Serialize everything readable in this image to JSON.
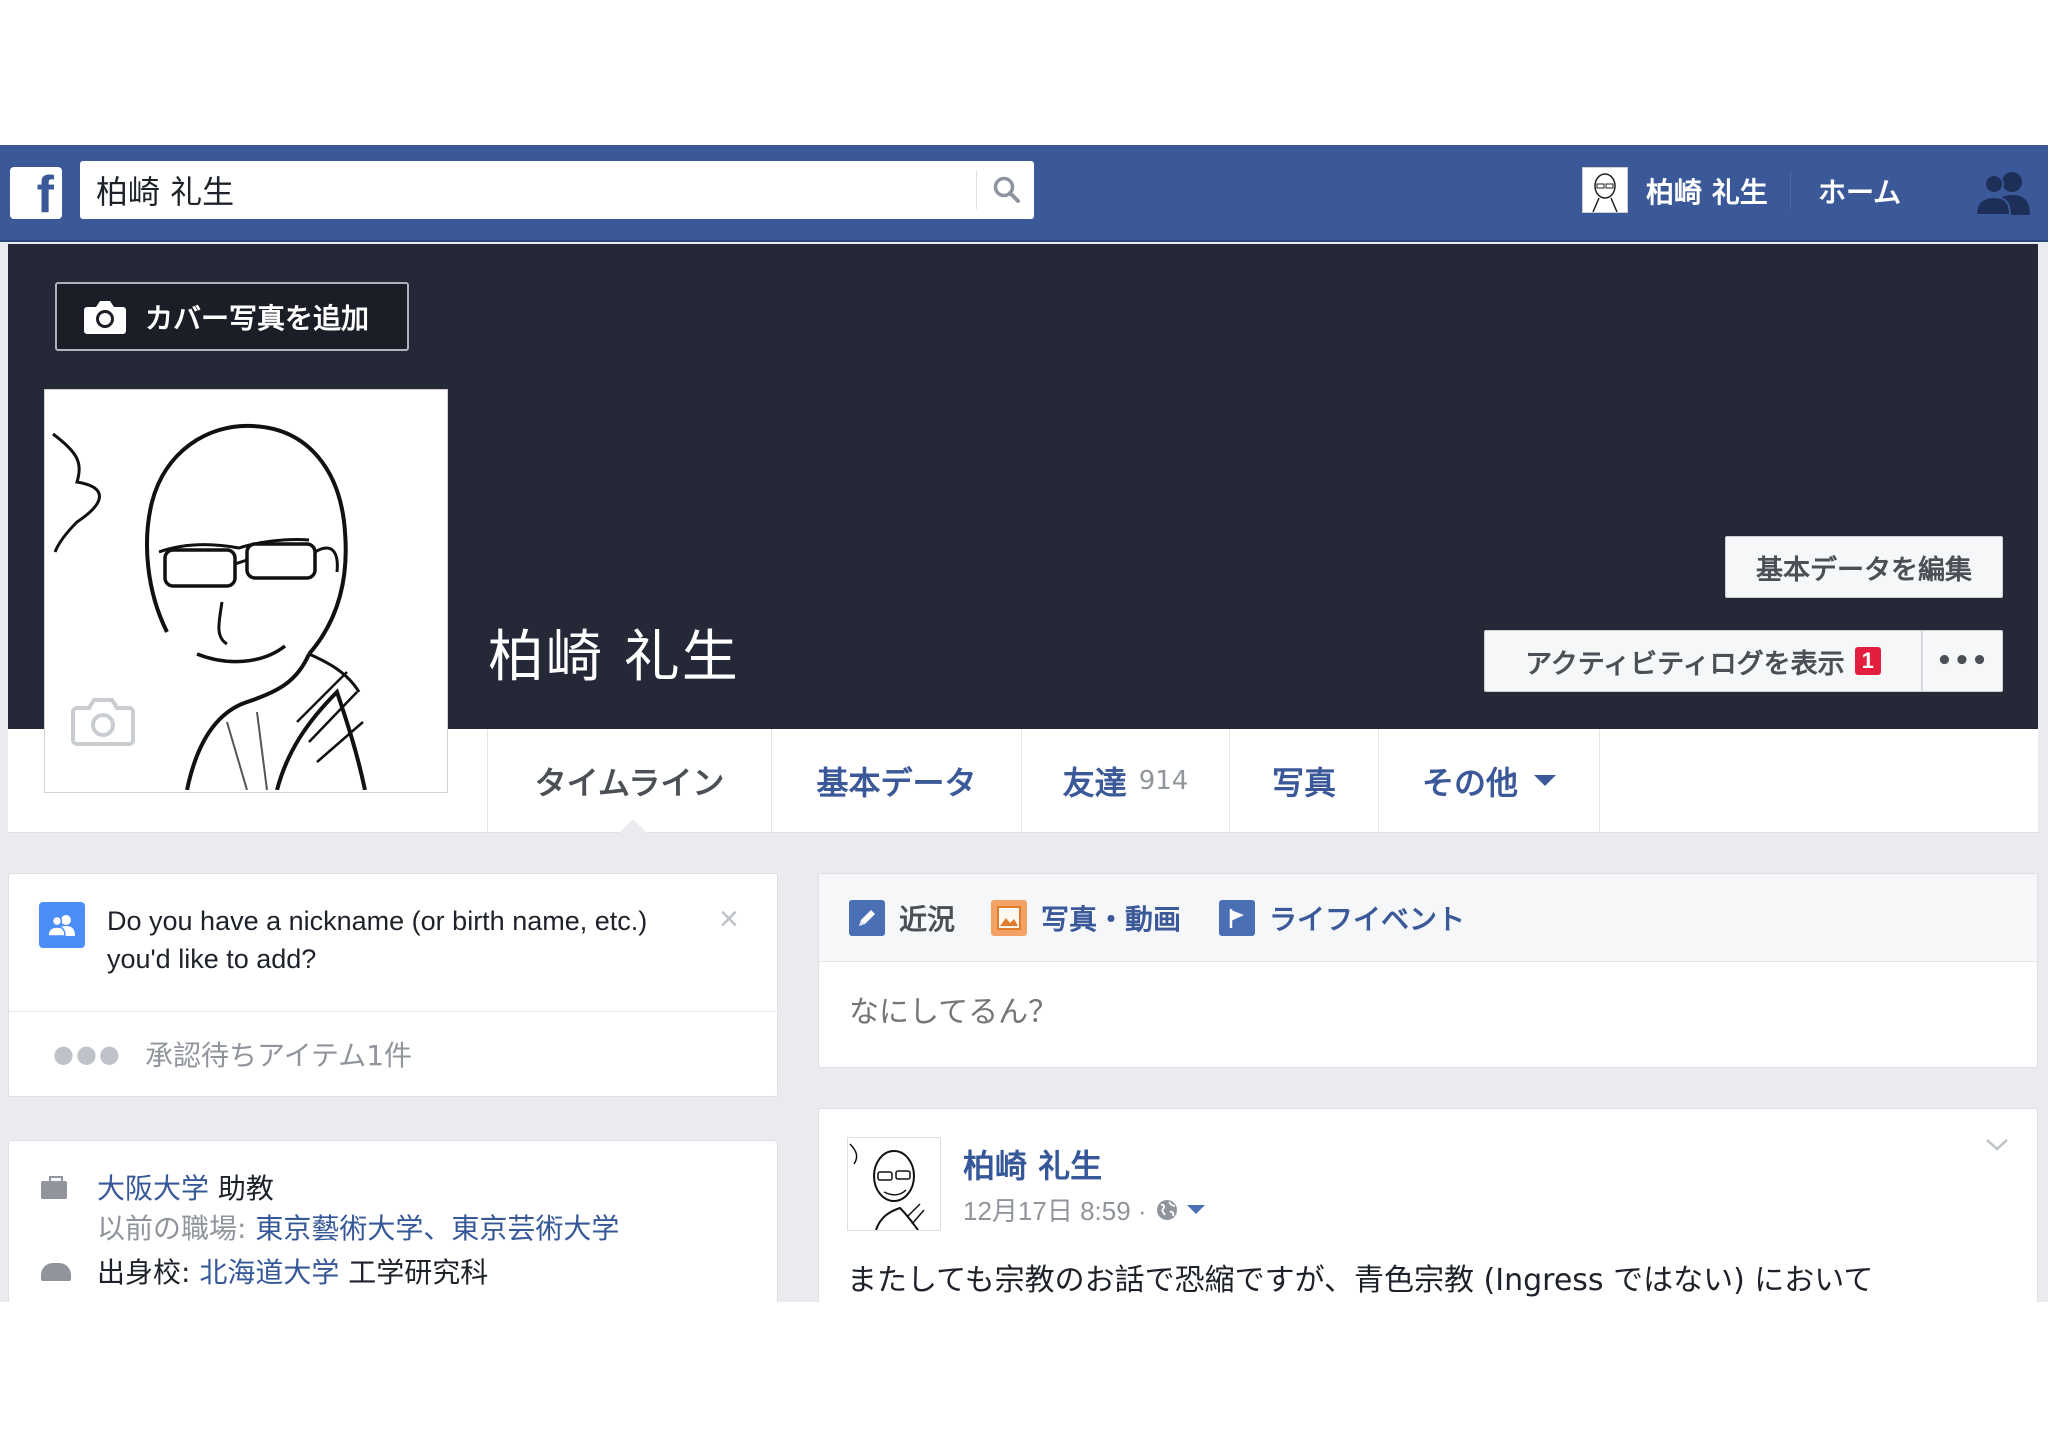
{
  "search": {
    "value": "柏崎 礼生"
  },
  "topnav": {
    "user_name": "柏崎 礼生",
    "home_label": "ホーム"
  },
  "logo": {
    "glyph": "f"
  },
  "cover": {
    "add_cover_label": "カバー写真を追加",
    "profile_name": "柏崎 礼生",
    "edit_basic_label": "基本データを編集",
    "activity_log_label": "アクティビティログを表示",
    "activity_badge": "1",
    "more_label": "•••"
  },
  "tabs": [
    {
      "label": "タイムライン"
    },
    {
      "label": "基本データ"
    },
    {
      "label": "友達",
      "count": "914"
    },
    {
      "label": "写真"
    },
    {
      "label": "その他"
    }
  ],
  "nickname_card": {
    "text": "Do you have a nickname (or birth name, etc.) you'd like to add?",
    "close": "×",
    "pending_dots": "●●●",
    "pending_text": "承認待ちアイテム1件"
  },
  "intro": {
    "work_org": "大阪大学",
    "work_role": " 助教",
    "prev_label": "以前の職場: ",
    "prev_orgs": "東京藝術大学、東京芸術大学",
    "edu_label": "出身校: ",
    "edu_school": "北海道大学",
    "edu_dept": " 工学研究科"
  },
  "composer": {
    "status_label": "近況",
    "photo_label": "写真・動画",
    "life_label": "ライフイベント",
    "placeholder": "なにしてるん？"
  },
  "post": {
    "author": "柏崎 礼生",
    "timestamp": "12月17日 8:59 ·",
    "body": "またしても宗教のお話で恐縮ですが、青色宗教 (Ingress ではない) において"
  },
  "colors": {
    "brand": "#3b5998",
    "cover": "#252837",
    "badge": "#e41e3f",
    "link": "#365899"
  },
  "icons": {
    "logo": "facebook-logo-icon",
    "search": "magnifier-icon",
    "friends": "friends-icon",
    "camera": "camera-icon",
    "pencil": "pencil-icon",
    "photo": "photo-icon",
    "flag": "flag-icon",
    "globe": "globe-icon",
    "chevron": "chevron-down-icon"
  }
}
